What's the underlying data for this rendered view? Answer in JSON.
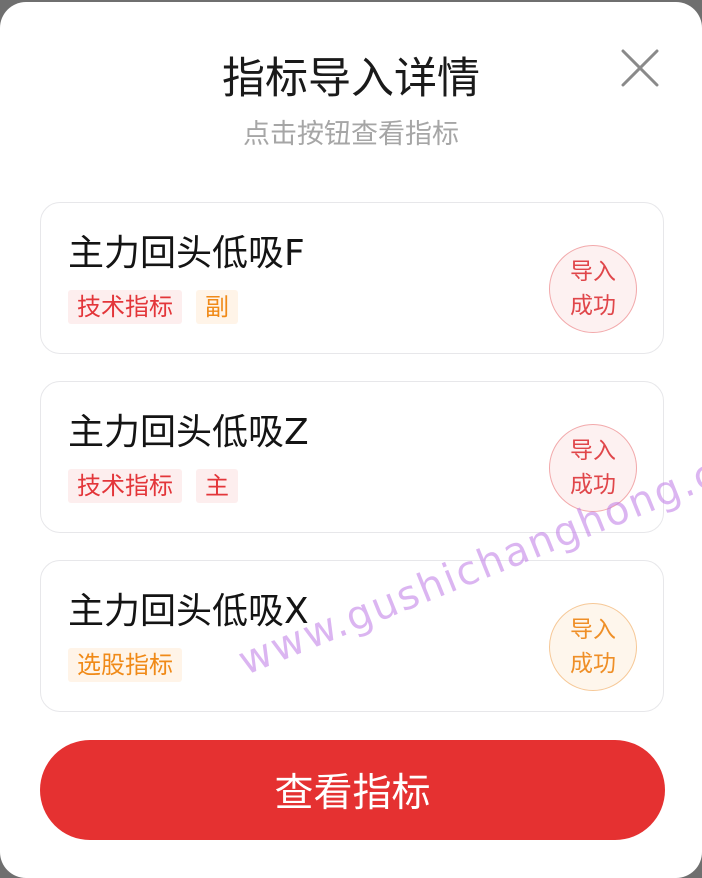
{
  "dialog": {
    "title": "指标导入详情",
    "subtitle": "点击按钮查看指标",
    "close_icon": "close-icon"
  },
  "cards": [
    {
      "name": "主力回头低吸F",
      "tags": [
        {
          "label": "技术指标",
          "color": "red"
        },
        {
          "label": "副",
          "color": "orange"
        }
      ],
      "status": {
        "line1": "导入",
        "line2": "成功",
        "color": "red"
      }
    },
    {
      "name": "主力回头低吸Z",
      "tags": [
        {
          "label": "技术指标",
          "color": "red"
        },
        {
          "label": "主",
          "color": "red"
        }
      ],
      "status": {
        "line1": "导入",
        "line2": "成功",
        "color": "red"
      }
    },
    {
      "name": "主力回头低吸X",
      "tags": [
        {
          "label": "选股指标",
          "color": "orange"
        }
      ],
      "status": {
        "line1": "导入",
        "line2": "成功",
        "color": "orange"
      }
    }
  ],
  "actions": {
    "view_label": "查看指标"
  },
  "watermark": "www.gushichanghong.com",
  "colors": {
    "accent_red": "#e53131",
    "tag_red": "#e3363a",
    "tag_orange": "#f08a18"
  }
}
